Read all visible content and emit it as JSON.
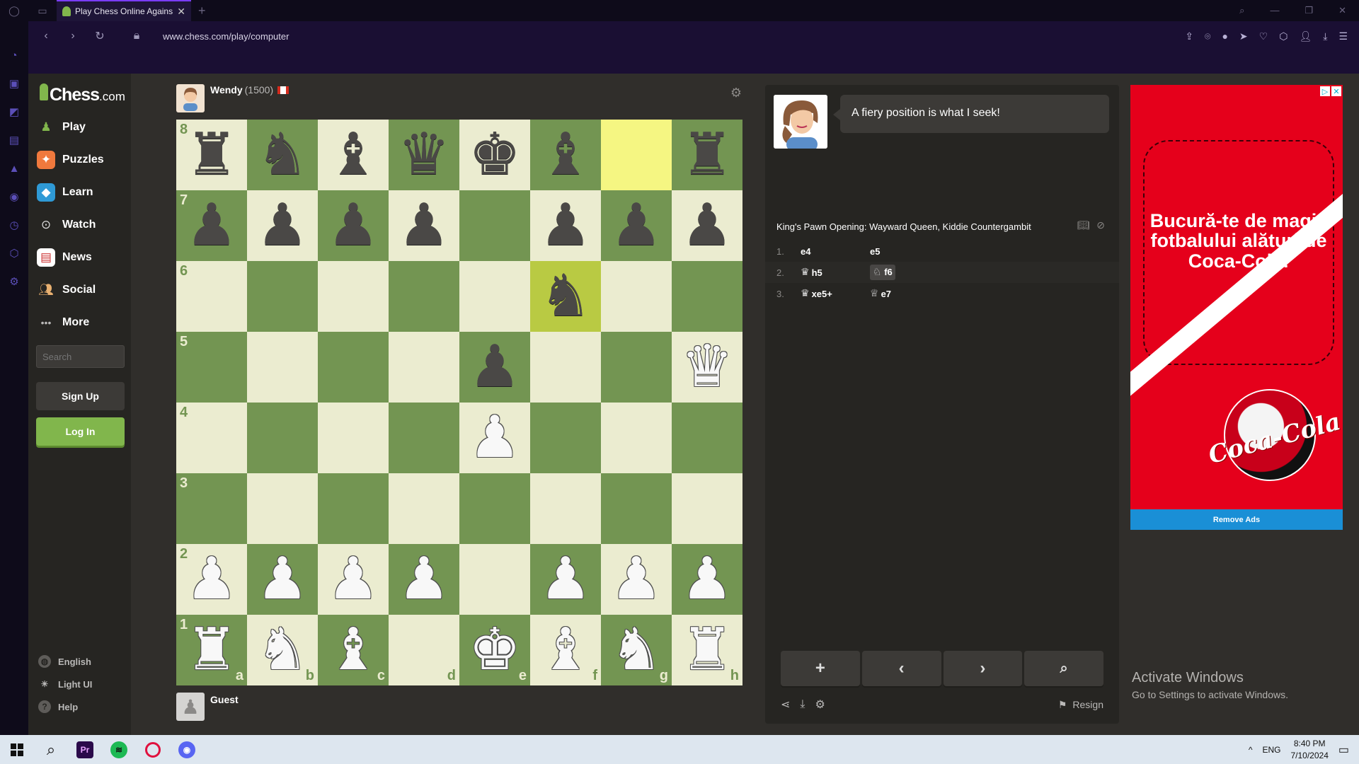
{
  "browser": {
    "tab_title": "Play Chess Online Against the Computer",
    "url": "www.chess.com/play/computer"
  },
  "nav": {
    "logo_text": "Chess",
    "logo_suffix": ".com",
    "items": [
      {
        "label": "Play"
      },
      {
        "label": "Puzzles"
      },
      {
        "label": "Learn"
      },
      {
        "label": "Watch"
      },
      {
        "label": "News"
      },
      {
        "label": "Social"
      },
      {
        "label": "More"
      }
    ],
    "search_placeholder": "Search",
    "signup": "Sign Up",
    "login": "Log In",
    "footer": [
      {
        "label": "English"
      },
      {
        "label": "Light UI"
      },
      {
        "label": "Help"
      }
    ]
  },
  "opponent": {
    "name": "Wendy",
    "rating": "(1500)"
  },
  "player": {
    "name": "Guest"
  },
  "board": {
    "ranks": [
      "8",
      "7",
      "6",
      "5",
      "4",
      "3",
      "2",
      "1"
    ],
    "files": [
      "a",
      "b",
      "c",
      "d",
      "e",
      "f",
      "g",
      "h"
    ],
    "rows": [
      [
        "br",
        "bn",
        "bb",
        "bq",
        "bk",
        "bb",
        "",
        "br"
      ],
      [
        "bp",
        "bp",
        "bp",
        "bp",
        "",
        "bp",
        "bp",
        "bp"
      ],
      [
        "",
        "",
        "",
        "",
        "",
        "bn",
        "",
        ""
      ],
      [
        "",
        "",
        "",
        "",
        "bp",
        "",
        "",
        "wq"
      ],
      [
        "",
        "",
        "",
        "",
        "wp",
        "",
        "",
        ""
      ],
      [
        "",
        "",
        "",
        "",
        "",
        "",
        "",
        ""
      ],
      [
        "wp",
        "wp",
        "wp",
        "wp",
        "",
        "wp",
        "wp",
        "wp"
      ],
      [
        "wr",
        "wn",
        "wb",
        "",
        "wk",
        "wb",
        "wn",
        "wr"
      ]
    ],
    "highlight": [
      "g8",
      "f6"
    ]
  },
  "chat": {
    "message": "A fiery position is what I seek!"
  },
  "opening": "King's Pawn Opening: Wayward Queen, Kiddie Countergambit",
  "moves": [
    {
      "num": "1.",
      "white": {
        "piece": "",
        "san": "e4"
      },
      "black": {
        "piece": "",
        "san": "e5"
      }
    },
    {
      "num": "2.",
      "white": {
        "piece": "queen",
        "san": "h5"
      },
      "black": {
        "piece": "knight",
        "san": "f6",
        "current": true
      }
    },
    {
      "num": "3.",
      "white": {
        "piece": "queen",
        "san": "xe5+"
      },
      "black": {
        "piece": "queen",
        "san": "e7"
      }
    }
  ],
  "panel": {
    "resign": "Resign"
  },
  "ad": {
    "headline": "Bucură-te de magia fotbalului alături de Coca-Cola!",
    "logo": "Coca-Cola",
    "remove": "Remove Ads"
  },
  "watermark": {
    "title": "Activate Windows",
    "subtitle": "Go to Settings to activate Windows."
  },
  "taskbar": {
    "lang": "ENG",
    "time": "8:40 PM",
    "date": "7/10/2024"
  },
  "colors": {
    "board_light": "#ebecd0",
    "board_dark": "#739552",
    "highlight_light": "#f5f682",
    "highlight_dark": "#b9ca43",
    "accent_green": "#81b64c"
  }
}
